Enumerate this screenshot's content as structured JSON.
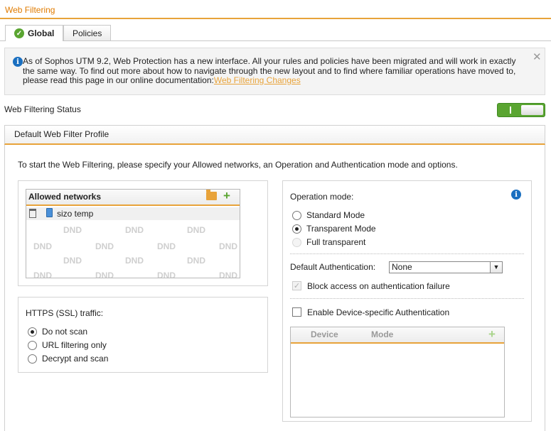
{
  "page": {
    "title": "Web Filtering"
  },
  "tabs": [
    {
      "label": "Global"
    },
    {
      "label": "Policies"
    }
  ],
  "notice": {
    "text": "As of Sophos UTM 9.2, Web Protection has a new interface. All your rules and policies have been migrated and will work in exactly the same way. To find out more about how to navigate through the new layout and to find where familiar operations have moved to, please read this page in our online documentation:",
    "link": "Web Filtering Changes",
    "close": "✕"
  },
  "status": {
    "label": "Web Filtering Status",
    "enabled": true
  },
  "profile": {
    "title": "Default Web Filter Profile",
    "intro": "To start the Web Filtering, please specify your Allowed networks, an Operation and Authentication mode and options."
  },
  "allowed_networks": {
    "title": "Allowed networks",
    "items": [
      {
        "name": "sizo temp"
      }
    ],
    "placeholder": "DND"
  },
  "https": {
    "label": "HTTPS (SSL) traffic:",
    "options": [
      "Do not scan",
      "URL filtering only",
      "Decrypt and scan"
    ],
    "selected": "Do not scan"
  },
  "operation": {
    "label": "Operation mode:",
    "options": [
      "Standard Mode",
      "Transparent Mode",
      "Full transparent"
    ],
    "selected": "Transparent Mode"
  },
  "authentication": {
    "label": "Default Authentication:",
    "value": "None",
    "block_label": "Block access on authentication failure",
    "block_checked": true,
    "device_label": "Enable Device-specific Authentication",
    "device_checked": false
  },
  "devices": {
    "columns": [
      "Device",
      "Mode"
    ]
  },
  "colors": {
    "accent": "#e8a33a",
    "toggle_on": "#5aa531",
    "info": "#1a6fc0"
  }
}
